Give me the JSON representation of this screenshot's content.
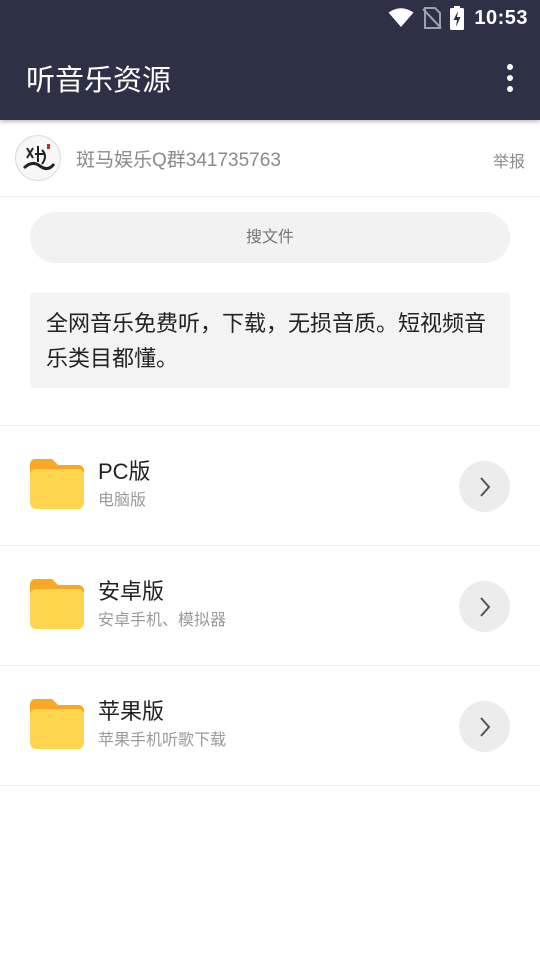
{
  "status_bar": {
    "time": "10:53",
    "icons": [
      "wifi-icon",
      "no-sim-icon",
      "battery-charging-icon"
    ]
  },
  "app_bar": {
    "title": "听音乐资源",
    "menu_icon": "more-vert-icon"
  },
  "group": {
    "name": "斑马娱乐Q群341735763",
    "report_label": "举报",
    "avatar_text": "斑马"
  },
  "search": {
    "placeholder": "搜文件"
  },
  "description": "全网音乐免费听，下载，无损音质。短视频音乐类目都懂。",
  "files": [
    {
      "name": "PC版",
      "subtitle": "电脑版"
    },
    {
      "name": "安卓版",
      "subtitle": "安卓手机、模拟器"
    },
    {
      "name": "苹果版",
      "subtitle": "苹果手机听歌下载"
    }
  ],
  "colors": {
    "app_bar": "#2e3045",
    "folder_front": "#ffd54f",
    "folder_back": "#f9a825",
    "chevron_bg": "#ececec"
  }
}
